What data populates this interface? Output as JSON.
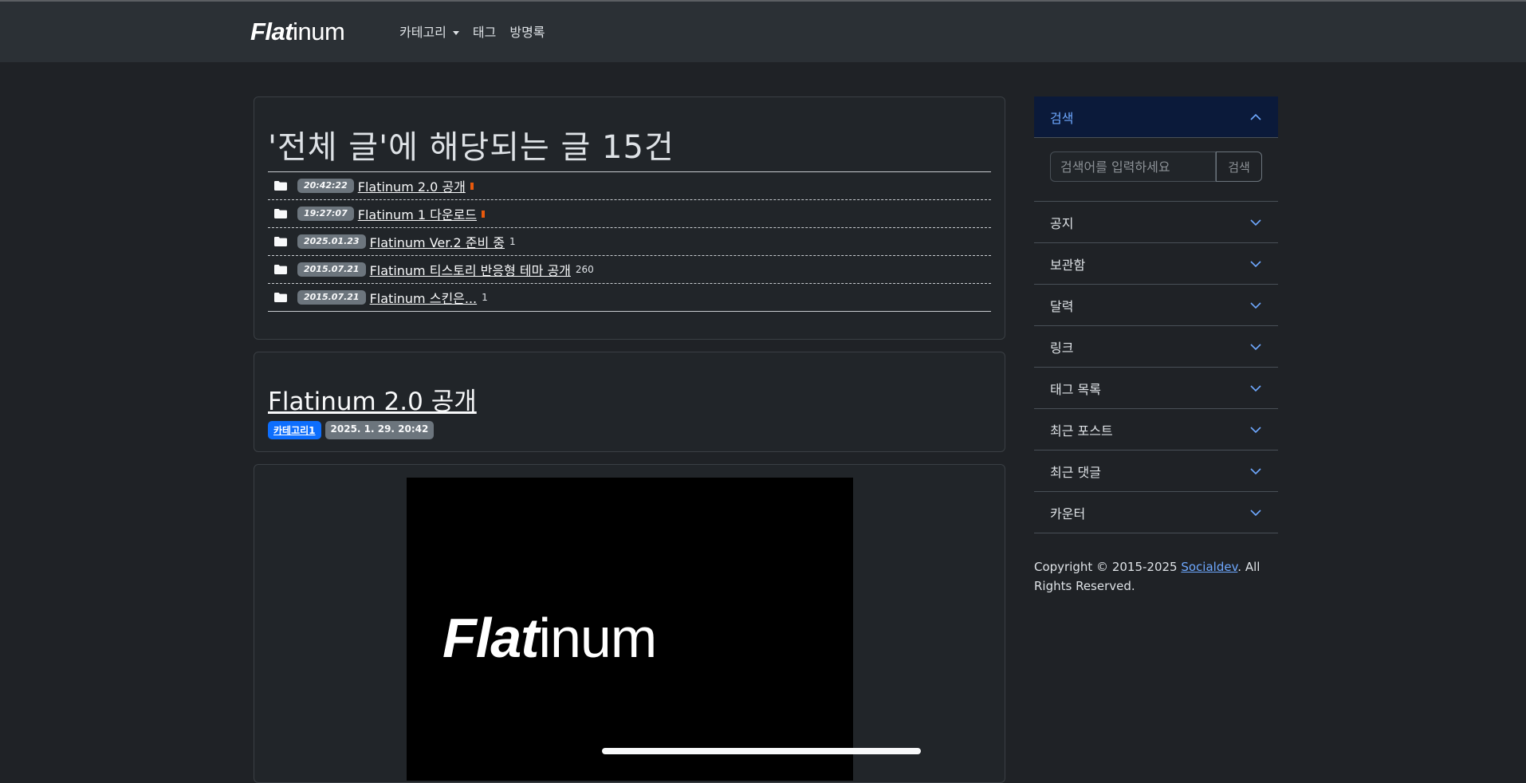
{
  "header": {
    "brand_bold": "Flat",
    "brand_light": "inum",
    "nav": [
      {
        "label": "카테고리"
      },
      {
        "label": "태그"
      },
      {
        "label": "방명록"
      }
    ]
  },
  "list": {
    "title": "'전체 글'에 해당되는 글 15건",
    "posts": [
      {
        "date": "20:42:22",
        "title": "Flatinum 2.0 공개",
        "comments": ""
      },
      {
        "date": "19:27:07",
        "title": "Flatinum 1 다운로드",
        "comments": ""
      },
      {
        "date": "2025.01.23",
        "title": "Flatinum Ver.2 준비 중",
        "comments": "1"
      },
      {
        "date": "2015.07.21",
        "title": "Flatinum 티스토리 반응형 테마 공개",
        "comments": "260"
      },
      {
        "date": "2015.07.21",
        "title": "Flatinum 스킨은...",
        "comments": "1"
      }
    ]
  },
  "post": {
    "title": "Flatinum 2.0 공개",
    "category": "카테고리1",
    "date": "2025. 1. 29. 20:42",
    "image_logo_bold": "Flat",
    "image_logo_light": "inum"
  },
  "sidebar": {
    "search": {
      "title": "검색",
      "placeholder": "검색어를 입력하세요",
      "button": "검색"
    },
    "sections": [
      {
        "label": "공지"
      },
      {
        "label": "보관함"
      },
      {
        "label": "달력"
      },
      {
        "label": "링크"
      },
      {
        "label": "태그 목록"
      },
      {
        "label": "최근 포스트"
      },
      {
        "label": "최근 댓글"
      },
      {
        "label": "카운터"
      }
    ],
    "copyright_prefix": "Copyright © 2015-2025 ",
    "copyright_link": "Socialdev",
    "copyright_suffix": ". All Rights Reserved."
  },
  "colors": {
    "background": "#1f2226",
    "navbar": "#2b3035",
    "primary": "#0d6efd",
    "link_blue": "#6ea8fe",
    "new_mark": "#e8590c"
  }
}
